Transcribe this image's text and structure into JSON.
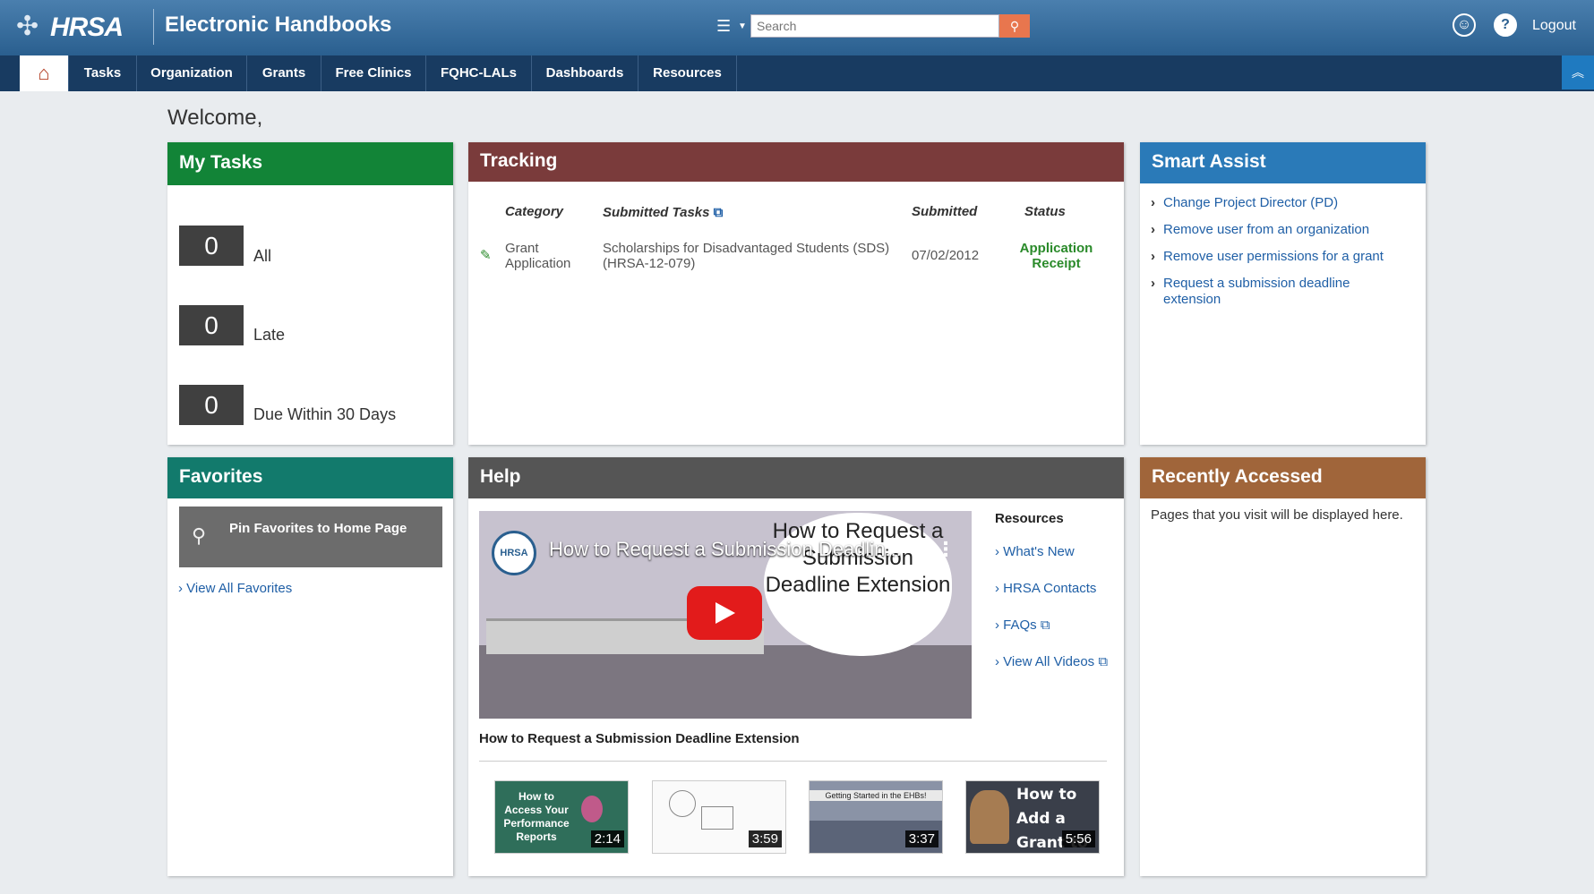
{
  "header": {
    "logo_text": "HRSA",
    "app_title": "Electronic Handbooks",
    "search_placeholder": "Search",
    "logout_label": "Logout",
    "icons": [
      "menu-icon",
      "search-icon",
      "user-icon",
      "help-icon"
    ]
  },
  "nav": {
    "items": [
      "Tasks",
      "Organization",
      "Grants",
      "Free Clinics",
      "FQHC-LALs",
      "Dashboards",
      "Resources"
    ]
  },
  "welcome": "Welcome,",
  "my_tasks": {
    "title": "My Tasks",
    "rows": [
      {
        "count": "0",
        "label": "All"
      },
      {
        "count": "0",
        "label": "Late"
      },
      {
        "count": "0",
        "label": "Due Within 30 Days"
      }
    ]
  },
  "tracking": {
    "title": "Tracking",
    "columns": [
      "Category",
      "Submitted Tasks",
      "Submitted",
      "Status"
    ],
    "rows": [
      {
        "category_line1": "Grant",
        "category_line2": "Application",
        "task_line1": "Scholarships for Disadvantaged Students (SDS)",
        "task_line2": "(HRSA-12-079)",
        "submitted": "07/02/2012",
        "status_line1": "Application",
        "status_line2": "Receipt"
      }
    ]
  },
  "smart_assist": {
    "title": "Smart Assist",
    "items": [
      "Change Project Director (PD)",
      "Remove user from an organization",
      "Remove user permissions for a grant",
      "Request a submission deadline extension"
    ]
  },
  "favorites": {
    "title": "Favorites",
    "pin_label": "Pin Favorites to Home Page",
    "view_all": "View All Favorites"
  },
  "help": {
    "title": "Help",
    "video": {
      "overlay_title": "How to Request a Submission Deadlin...",
      "bubble_text": "How to Request a Submission Deadline Extension",
      "logo_text": "HRSA",
      "caption": "How to Request a Submission Deadline Extension"
    },
    "resources_title": "Resources",
    "resources": [
      "What's New",
      "HRSA Contacts",
      "FAQs",
      "View All Videos"
    ],
    "thumbnails": [
      {
        "text": "How to Access Your Performance Reports",
        "duration": "2:14"
      },
      {
        "text": "",
        "duration": "3:59"
      },
      {
        "text": "Getting Started in the EHBs!",
        "duration": "3:37"
      },
      {
        "text": "How to Add a Grant to the EHBs P...",
        "duration": "5:56"
      }
    ]
  },
  "recently_accessed": {
    "title": "Recently Accessed",
    "text": "Pages that you visit will be displayed here."
  },
  "colors": {
    "my_tasks": "#128437",
    "tracking": "#7a3b3b",
    "smart_assist": "#2a7ab8",
    "favorites": "#127a6c",
    "help": "#555555",
    "recently_accessed": "#a0653a",
    "nav_bg": "#183b61",
    "status_green": "#2a8a2a",
    "link_blue": "#1f5fa6"
  }
}
